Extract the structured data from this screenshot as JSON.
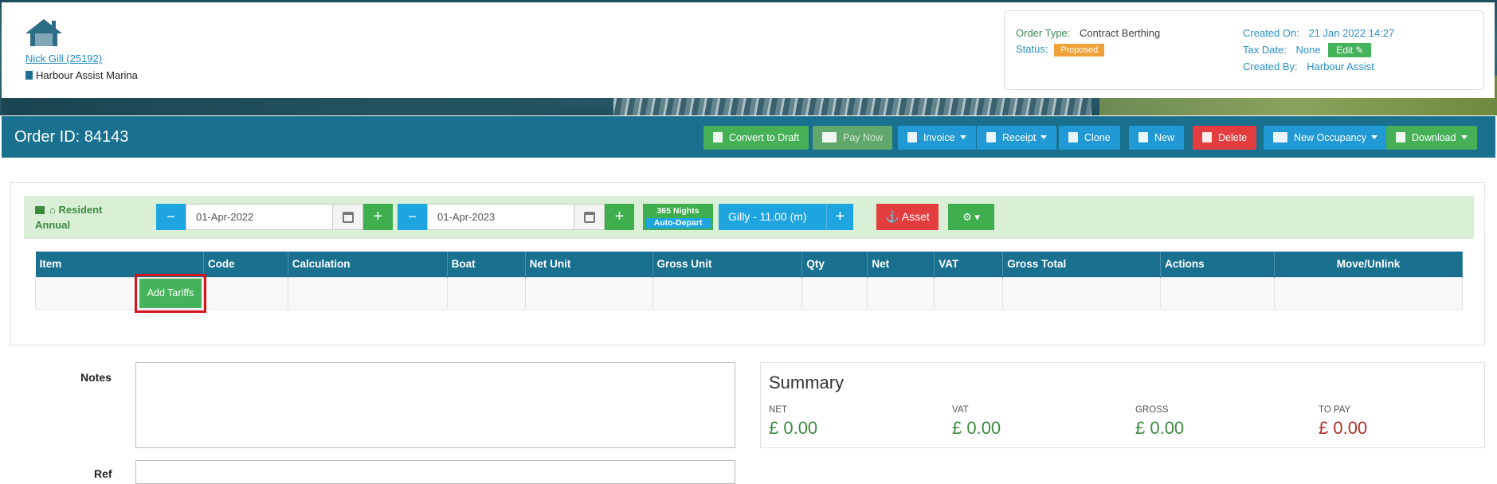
{
  "header": {
    "customer_link": "Nick Gill (25192)",
    "marina": "Harbour Assist Marina",
    "order_type_label": "Order Type:",
    "order_type_value": "Contract Berthing",
    "status_label": "Status:",
    "status_value": "Proposed",
    "created_on_label": "Created On:",
    "created_on_value": "21 Jan 2022 14:27",
    "tax_date_label": "Tax Date:",
    "tax_date_value": "None",
    "edit_label": "Edit",
    "created_by_label": "Created By:",
    "created_by_value": "Harbour Assist"
  },
  "order_bar": {
    "title": "Order ID: 84143",
    "buttons": {
      "convert": "Convert to Draft",
      "pay_now": "Pay Now",
      "invoice": "Invoice",
      "receipt": "Receipt",
      "clone": "Clone",
      "new": "New",
      "delete": "Delete",
      "new_occupancy": "New Occupancy",
      "download": "Download"
    }
  },
  "booking": {
    "berth_type_line1": "Resident",
    "berth_type_line2": "Annual",
    "start_date": "01-Apr-2022",
    "end_date": "01-Apr-2023",
    "nights": "365 Nights",
    "auto_depart": "Auto-Depart",
    "boat": "Gilly - 11.00 (m)",
    "asset": "Asset"
  },
  "table": {
    "headers": [
      "Item",
      "Code",
      "Calculation",
      "Boat",
      "Net Unit",
      "Gross Unit",
      "Qty",
      "Net",
      "VAT",
      "Gross Total",
      "Actions",
      "Move/Unlink"
    ],
    "add_tariffs": "Add Tariffs"
  },
  "notes": {
    "label": "Notes",
    "ref_label": "Ref"
  },
  "summary": {
    "title": "Summary",
    "net_label": "NET",
    "net_value": "£ 0.00",
    "vat_label": "VAT",
    "vat_value": "£ 0.00",
    "gross_label": "GROSS",
    "gross_value": "£ 0.00",
    "topay_label": "TO PAY",
    "topay_value": "£ 0.00"
  },
  "colors": {
    "primary_bar": "#19708f",
    "green": "#45b35a",
    "blue": "#2199d4",
    "red": "#e43d3f",
    "orange_badge": "#f0a23a"
  }
}
